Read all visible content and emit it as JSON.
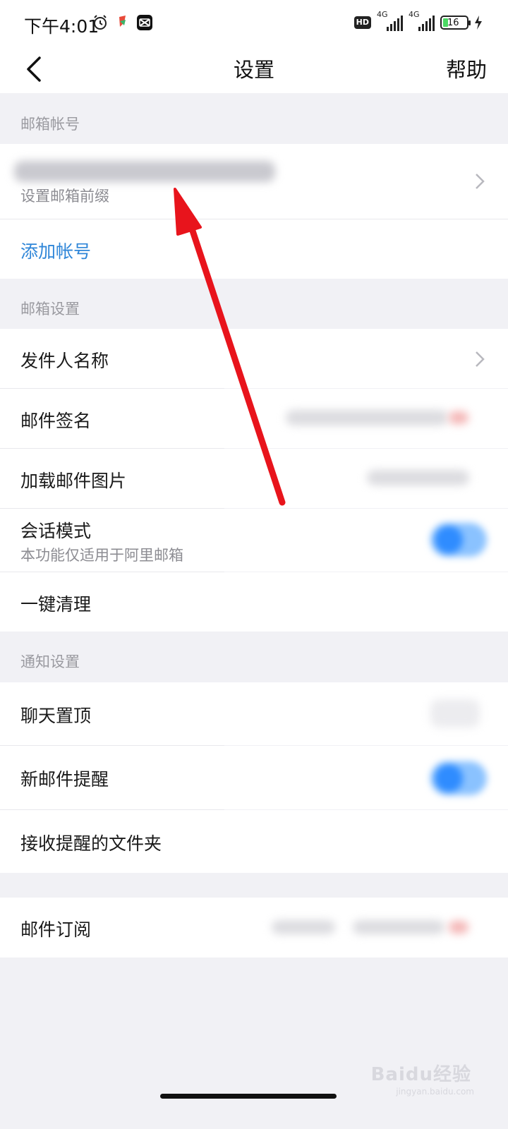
{
  "status_bar": {
    "time": "下午4:01",
    "hd_label": "HD",
    "net1_label": "4G",
    "net2_label": "4G",
    "battery": "16"
  },
  "nav": {
    "title": "设置",
    "help_label": "帮助"
  },
  "sections": {
    "account_header": "邮箱帐号",
    "account_sub": "设置邮箱前缀",
    "add_account": "添加帐号",
    "mail_header": "邮箱设置",
    "notify_header": "通知设置"
  },
  "mail_settings": {
    "sender_name": "发件人名称",
    "signature": "邮件签名",
    "load_images": "加载邮件图片",
    "conversation_mode": "会话模式",
    "conversation_sub": "本功能仅适用于阿里邮箱",
    "one_click_clean": "一键清理"
  },
  "notify_settings": {
    "pin_chat": "聊天置顶",
    "new_mail_alert": "新邮件提醒",
    "alert_folders": "接收提醒的文件夹"
  },
  "subscription": {
    "label": "邮件订阅"
  },
  "watermark": {
    "brand": "Baidu经验",
    "url": "jingyan.baidu.com"
  },
  "colors": {
    "accent_blue": "#2f86d8",
    "toggle_blue": "#2f8cff",
    "arrow_red": "#e8141c"
  }
}
